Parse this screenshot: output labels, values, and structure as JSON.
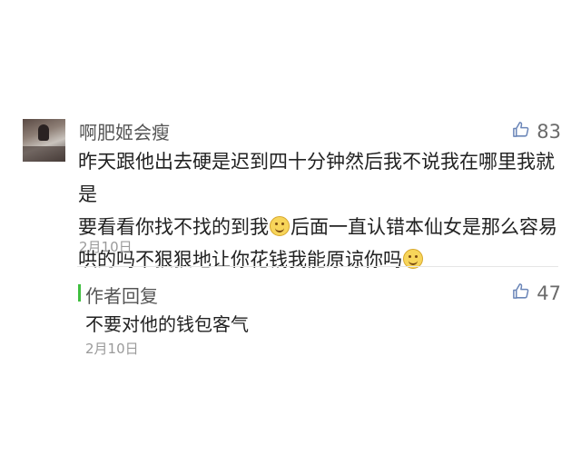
{
  "comment": {
    "nickname": "啊肥姬会瘦",
    "likes": "83",
    "text_line1": "昨天跟他出去硬是迟到四十分钟然后我不说我在哪里我就是",
    "text_line2a": "要看看你找不找的到我",
    "text_line2b": "后面一直认错本仙女是那么容易",
    "text_line3": "哄的吗不狠狠地让你花钱我能原谅你吗",
    "date": "2月10日"
  },
  "reply": {
    "label": "作者回复",
    "likes": "47",
    "text": "不要对他的钱包客气",
    "date": "2月10日"
  },
  "colors": {
    "reply_accent": "#3fbf3f",
    "text": "#222222",
    "meta": "#9a9a9a"
  }
}
